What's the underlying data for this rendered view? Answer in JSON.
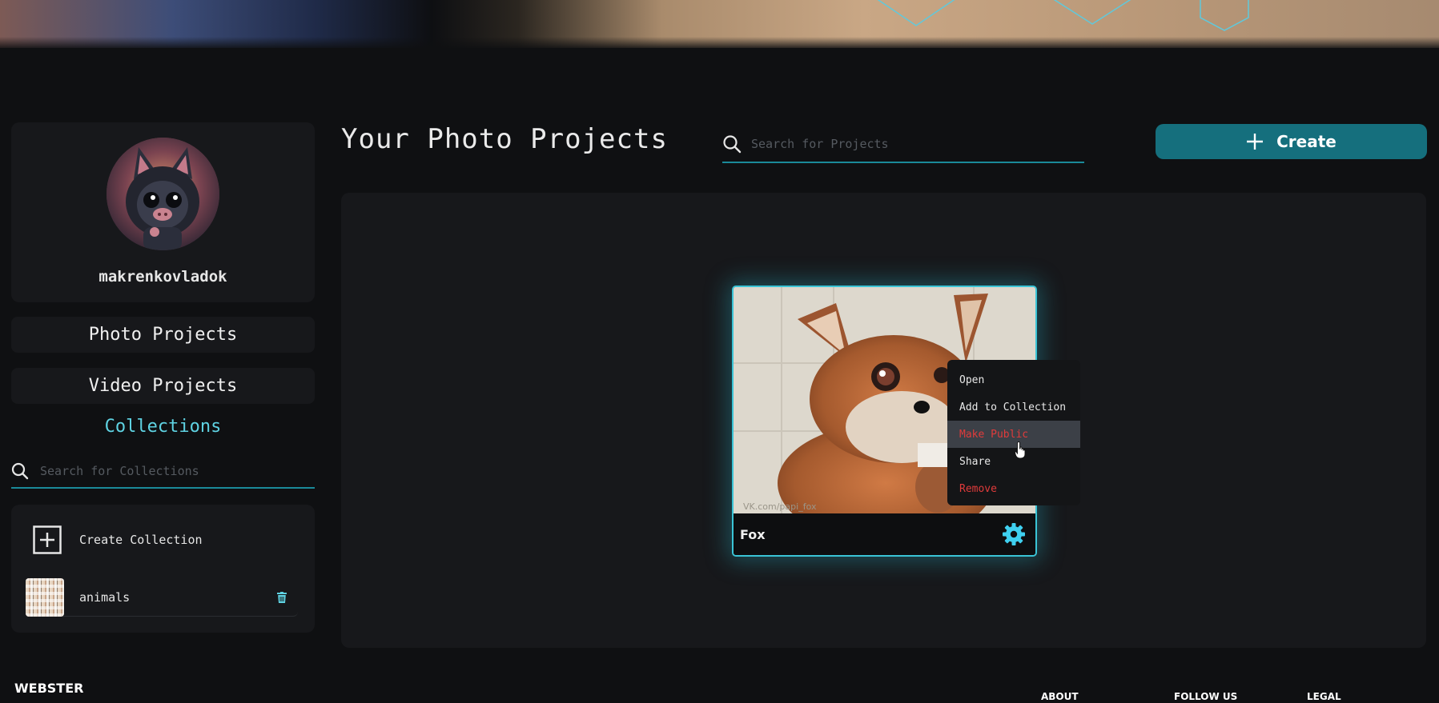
{
  "header": {
    "title": "Your Photo Projects",
    "search_placeholder": "Search for Projects",
    "create_label": "Create"
  },
  "profile": {
    "username": "makrenkovladok"
  },
  "sidebar": {
    "nav": [
      {
        "label": "Photo Projects"
      },
      {
        "label": "Video Projects"
      }
    ],
    "collections_title": "Collections",
    "collections_search_placeholder": "Search for Collections",
    "create_collection_label": "Create Collection",
    "collections": [
      {
        "name": "animals"
      }
    ]
  },
  "project": {
    "name": "Fox",
    "watermark": "VK.com/papi_fox"
  },
  "context_menu": {
    "items": [
      {
        "label": "Open"
      },
      {
        "label": "Add to Collection"
      },
      {
        "label": "Make Public"
      },
      {
        "label": "Share"
      },
      {
        "label": "Remove"
      }
    ]
  },
  "footer": {
    "brand": "WEBSTER",
    "links": [
      {
        "label": "ABOUT"
      },
      {
        "label": "FOLLOW US"
      },
      {
        "label": "LEGAL"
      }
    ]
  },
  "colors": {
    "accent": "#156f7d",
    "accent_light": "#5fd3e3",
    "danger": "#e03b3b",
    "background": "#0f1012",
    "panel": "#17181b"
  }
}
